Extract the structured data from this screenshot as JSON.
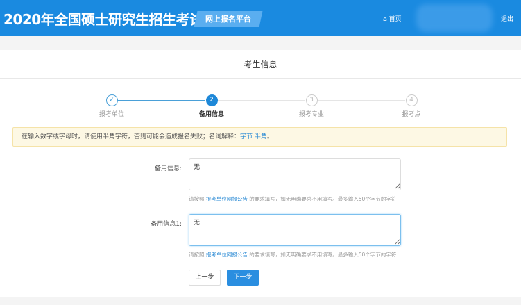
{
  "header": {
    "title": "2020年全国硕士研究生招生考试",
    "platform": "网上报名平台",
    "home": "首页",
    "logout": "退出",
    "color": "#1a8ae0"
  },
  "card_title": "考生信息",
  "steps": [
    {
      "num": "✓",
      "label": "报考单位",
      "state": "done"
    },
    {
      "num": "2",
      "label": "备用信息",
      "state": "active"
    },
    {
      "num": "3",
      "label": "报考专业",
      "state": "todo"
    },
    {
      "num": "4",
      "label": "报考点",
      "state": "todo"
    }
  ],
  "alert": {
    "text": "在输入数字或字母时，请使用半角字符，否则可能会造成报名失败；名词解释：",
    "link1": "字节",
    "link2": "半角",
    "end": "。"
  },
  "fields": [
    {
      "label": "备用信息:",
      "value": "无",
      "hint_pre": "请按照 ",
      "hint_link": "报考单位网报公告",
      "hint_post": " 的要求填写，如无明确要求不用填写。最多输入50个字节的字符"
    },
    {
      "label": "备用信息1:",
      "value": "无",
      "hint_pre": "请按照 ",
      "hint_link": "报考单位网报公告",
      "hint_post": " 的要求填写，如无明确要求不用填写。最多输入50个字节的字符"
    }
  ],
  "buttons": {
    "prev": "上一步",
    "next": "下一步"
  }
}
